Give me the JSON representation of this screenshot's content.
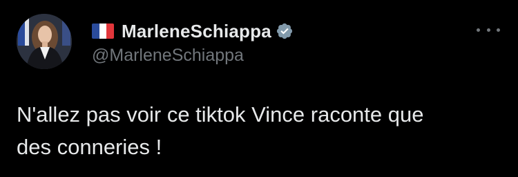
{
  "tweet": {
    "author": {
      "display_name": "MarleneSchiappa",
      "handle": "@MarleneSchiappa",
      "avatar_icon": "profile-photo",
      "flag_icon": "france-flag-icon",
      "verified_icon": "verified-badge-icon"
    },
    "more_icon": "more-dots-icon",
    "text": "N'allez pas voir ce tiktok Vince raconte que\ndes conneries !"
  },
  "colors": {
    "background": "#000000",
    "primary_text": "#e7e9ea",
    "secondary_text": "#71767b",
    "verified_badge": "#829aab",
    "flag_blue": "#2a4b9b",
    "flag_white": "#ffffff",
    "flag_red": "#e2363b"
  }
}
